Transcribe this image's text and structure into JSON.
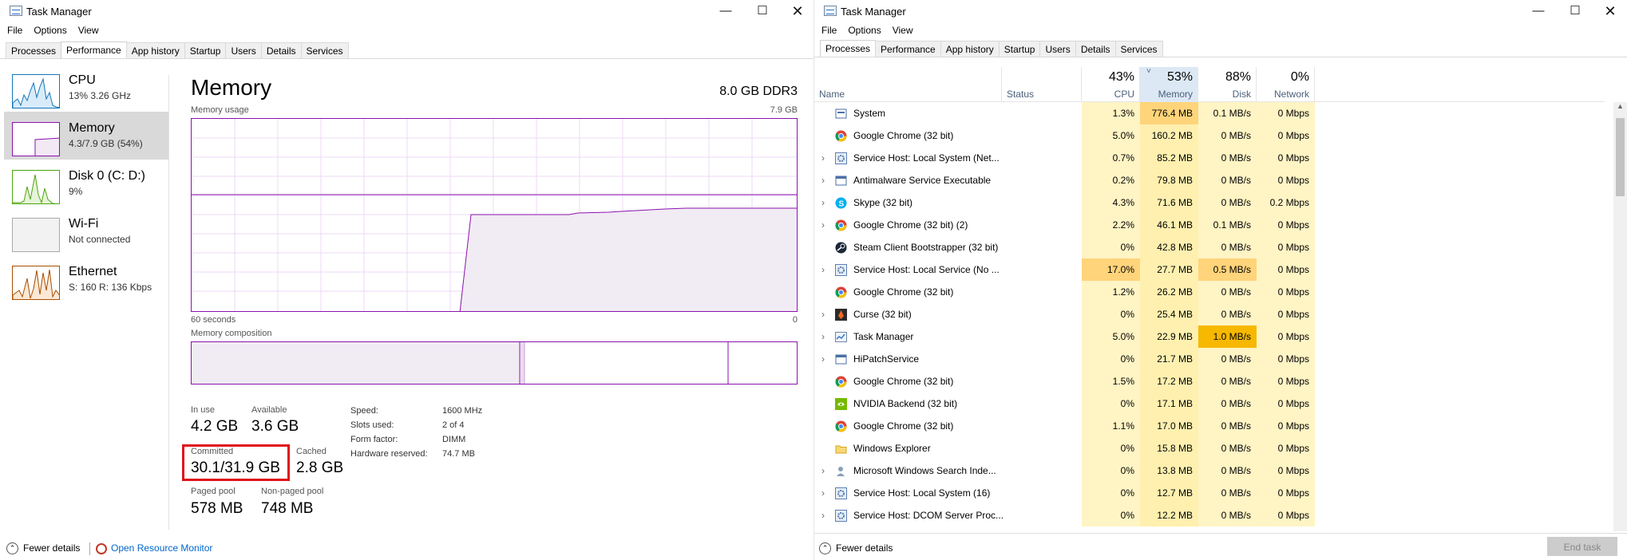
{
  "left_window": {
    "title": "Task Manager",
    "menu": [
      "File",
      "Options",
      "View"
    ],
    "tabs": [
      "Processes",
      "Performance",
      "App history",
      "Startup",
      "Users",
      "Details",
      "Services"
    ],
    "active_tab": "Performance",
    "sidebar": [
      {
        "title": "CPU",
        "subtitle": "13%  3.26 GHz",
        "color": "#1177bb"
      },
      {
        "title": "Memory",
        "subtitle": "4.3/7.9 GB (54%)",
        "color": "#8b12ae"
      },
      {
        "title": "Disk 0 (C: D:)",
        "subtitle": "9%",
        "color": "#4da60c"
      },
      {
        "title": "Wi-Fi",
        "subtitle": "Not connected",
        "color": "#999999"
      },
      {
        "title": "Ethernet",
        "subtitle": "S: 160  R: 136 Kbps",
        "color": "#a74f01"
      }
    ],
    "memory": {
      "title": "Memory",
      "spec": "8.0 GB DDR3",
      "usage_label": "Memory usage",
      "max_label": "7.9 GB",
      "time_left": "60 seconds",
      "time_right": "0",
      "composition_label": "Memory composition",
      "stats": {
        "in_use_label": "In use",
        "in_use": "4.2 GB",
        "available_label": "Available",
        "available": "3.6 GB",
        "committed_label": "Committed",
        "committed": "30.1/31.9 GB",
        "cached_label": "Cached",
        "cached": "2.8 GB",
        "paged_label": "Paged pool",
        "paged": "578 MB",
        "nonpaged_label": "Non-paged pool",
        "nonpaged": "748 MB"
      },
      "details": [
        {
          "k": "Speed:",
          "v": "1600 MHz"
        },
        {
          "k": "Slots used:",
          "v": "2 of 4"
        },
        {
          "k": "Form factor:",
          "v": "DIMM"
        },
        {
          "k": "Hardware reserved:",
          "v": "74.7 MB"
        }
      ]
    },
    "footer": {
      "fewer": "Fewer details",
      "monitor": "Open Resource Monitor"
    }
  },
  "right_window": {
    "title": "Task Manager",
    "menu": [
      "File",
      "Options",
      "View"
    ],
    "tabs": [
      "Processes",
      "Performance",
      "App history",
      "Startup",
      "Users",
      "Details",
      "Services"
    ],
    "active_tab": "Processes",
    "columns": {
      "name": "Name",
      "status": "Status",
      "cpu_pct": "43%",
      "cpu": "CPU",
      "mem_pct": "53%",
      "mem": "Memory",
      "disk_pct": "88%",
      "disk": "Disk",
      "net_pct": "0%",
      "net": "Network"
    },
    "processes": [
      {
        "name": "System",
        "exp": false,
        "icon": "system-icon",
        "cpu": "1.3%",
        "mem": "776.4 MB",
        "disk": "0.1 MB/s",
        "net": "0 Mbps",
        "memHeat": 3,
        "diskHeat": 0,
        "cpuHeat": 0
      },
      {
        "name": "Google Chrome (32 bit)",
        "exp": false,
        "icon": "chrome-icon",
        "cpu": "5.0%",
        "mem": "160.2 MB",
        "disk": "0 MB/s",
        "net": "0 Mbps",
        "memHeat": 1,
        "diskHeat": 0,
        "cpuHeat": 0
      },
      {
        "name": "Service Host: Local System (Net...",
        "exp": true,
        "icon": "gear-icon",
        "cpu": "0.7%",
        "mem": "85.2 MB",
        "disk": "0 MB/s",
        "net": "0 Mbps",
        "memHeat": 1,
        "diskHeat": 0,
        "cpuHeat": 0
      },
      {
        "name": "Antimalware Service Executable",
        "exp": true,
        "icon": "window-icon",
        "cpu": "0.2%",
        "mem": "79.8 MB",
        "disk": "0 MB/s",
        "net": "0 Mbps",
        "memHeat": 1,
        "diskHeat": 0,
        "cpuHeat": 0
      },
      {
        "name": "Skype (32 bit)",
        "exp": true,
        "icon": "skype-icon",
        "cpu": "4.3%",
        "mem": "71.6 MB",
        "disk": "0 MB/s",
        "net": "0.2 Mbps",
        "memHeat": 1,
        "diskHeat": 0,
        "cpuHeat": 0
      },
      {
        "name": "Google Chrome (32 bit) (2)",
        "exp": true,
        "icon": "chrome-icon",
        "cpu": "2.2%",
        "mem": "46.1 MB",
        "disk": "0.1 MB/s",
        "net": "0 Mbps",
        "memHeat": 1,
        "diskHeat": 0,
        "cpuHeat": 0
      },
      {
        "name": "Steam Client Bootstrapper (32 bit)",
        "exp": false,
        "icon": "steam-icon",
        "cpu": "0%",
        "mem": "42.8 MB",
        "disk": "0 MB/s",
        "net": "0 Mbps",
        "memHeat": 1,
        "diskHeat": 0,
        "cpuHeat": 0
      },
      {
        "name": "Service Host: Local Service (No ...",
        "exp": true,
        "icon": "gear-icon",
        "cpu": "17.0%",
        "mem": "27.7 MB",
        "disk": "0.5 MB/s",
        "net": "0 Mbps",
        "memHeat": 1,
        "diskHeat": 2,
        "cpuHeat": 2
      },
      {
        "name": "Google Chrome (32 bit)",
        "exp": false,
        "icon": "chrome-icon",
        "cpu": "1.2%",
        "mem": "26.2 MB",
        "disk": "0 MB/s",
        "net": "0 Mbps",
        "memHeat": 1,
        "diskHeat": 0,
        "cpuHeat": 0
      },
      {
        "name": "Curse (32 bit)",
        "exp": true,
        "icon": "curse-icon",
        "cpu": "0%",
        "mem": "25.4 MB",
        "disk": "0 MB/s",
        "net": "0 Mbps",
        "memHeat": 1,
        "diskHeat": 0,
        "cpuHeat": 0
      },
      {
        "name": "Task Manager",
        "exp": true,
        "icon": "taskmgr-icon",
        "cpu": "5.0%",
        "mem": "22.9 MB",
        "disk": "1.0 MB/s",
        "net": "0 Mbps",
        "memHeat": 1,
        "diskHeat": 3,
        "cpuHeat": 0
      },
      {
        "name": "HiPatchService",
        "exp": true,
        "icon": "window-icon",
        "cpu": "0%",
        "mem": "21.7 MB",
        "disk": "0 MB/s",
        "net": "0 Mbps",
        "memHeat": 1,
        "diskHeat": 0,
        "cpuHeat": 0
      },
      {
        "name": "Google Chrome (32 bit)",
        "exp": false,
        "icon": "chrome-icon",
        "cpu": "1.5%",
        "mem": "17.2 MB",
        "disk": "0 MB/s",
        "net": "0 Mbps",
        "memHeat": 1,
        "diskHeat": 0,
        "cpuHeat": 0
      },
      {
        "name": "NVIDIA Backend (32 bit)",
        "exp": false,
        "icon": "nvidia-icon",
        "cpu": "0%",
        "mem": "17.1 MB",
        "disk": "0 MB/s",
        "net": "0 Mbps",
        "memHeat": 1,
        "diskHeat": 0,
        "cpuHeat": 0
      },
      {
        "name": "Google Chrome (32 bit)",
        "exp": false,
        "icon": "chrome-icon",
        "cpu": "1.1%",
        "mem": "17.0 MB",
        "disk": "0 MB/s",
        "net": "0 Mbps",
        "memHeat": 1,
        "diskHeat": 0,
        "cpuHeat": 0
      },
      {
        "name": "Windows Explorer",
        "exp": false,
        "icon": "folder-icon",
        "cpu": "0%",
        "mem": "15.8 MB",
        "disk": "0 MB/s",
        "net": "0 Mbps",
        "memHeat": 1,
        "diskHeat": 0,
        "cpuHeat": 0
      },
      {
        "name": "Microsoft Windows Search Inde...",
        "exp": true,
        "icon": "search-person-icon",
        "cpu": "0%",
        "mem": "13.8 MB",
        "disk": "0 MB/s",
        "net": "0 Mbps",
        "memHeat": 1,
        "diskHeat": 0,
        "cpuHeat": 0
      },
      {
        "name": "Service Host: Local System (16)",
        "exp": true,
        "icon": "gear-icon",
        "cpu": "0%",
        "mem": "12.7 MB",
        "disk": "0 MB/s",
        "net": "0 Mbps",
        "memHeat": 1,
        "diskHeat": 0,
        "cpuHeat": 0
      },
      {
        "name": "Service Host: DCOM Server Proc...",
        "exp": true,
        "icon": "gear-icon",
        "cpu": "0%",
        "mem": "12.2 MB",
        "disk": "0 MB/s",
        "net": "0 Mbps",
        "memHeat": 1,
        "diskHeat": 0,
        "cpuHeat": 0
      }
    ],
    "footer": {
      "fewer": "Fewer details",
      "end_task": "End task"
    }
  }
}
